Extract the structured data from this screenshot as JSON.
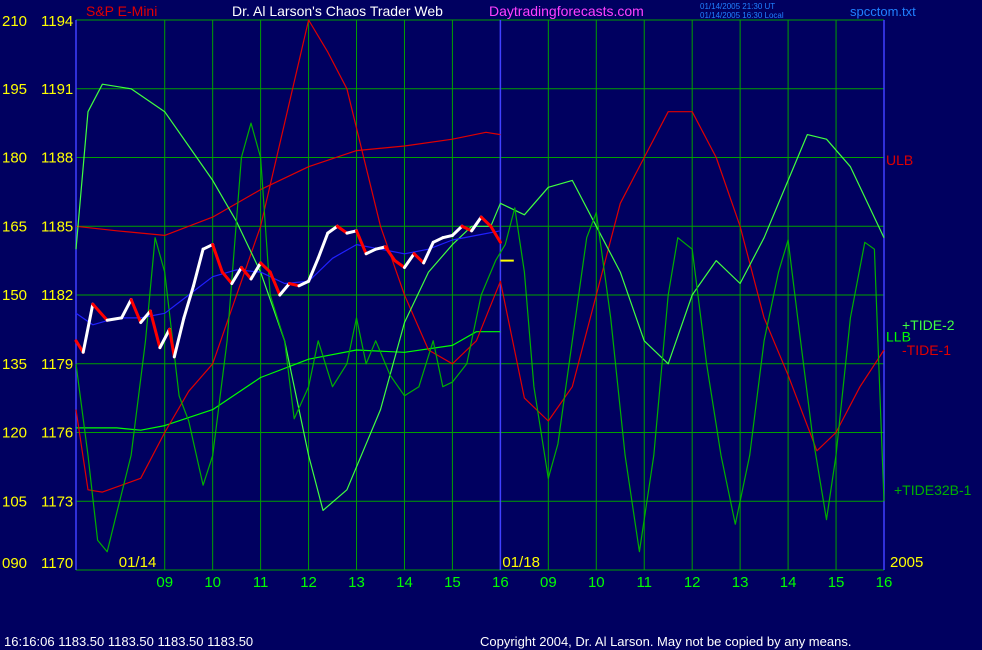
{
  "header": {
    "instrument": "S&P E-Mini",
    "title": "Dr. Al Larson's Chaos Trader Web",
    "site": "Daytradingforecasts.com",
    "stamp_ut": "01/14/2005 21:30 UT",
    "stamp_local": "01/14/2005 16:30 Local",
    "file": "spcctom.txt"
  },
  "footer": {
    "quote": "16:16:06  1183.50 1183.50 1183.50 1183.50",
    "copyright": "Copyright 2004, Dr. Al Larson. May not be copied by any means."
  },
  "colors": {
    "background": "#000060",
    "grid": "#00a000",
    "divider": "#4040ff",
    "left_axis": "#ffff00",
    "hour_labels": "#00ff00",
    "ulb": "#e00000",
    "llb": "#00ff00",
    "tide1": "#e00000",
    "tide2": "#40ff40",
    "tide32": "#00b000",
    "price_up": "#ffffff",
    "price_down": "#ff0000",
    "moving_avg": "#2020ff",
    "last_tick": "#ffff00"
  },
  "chart_data": {
    "type": "line",
    "left_axis": {
      "pairs": [
        {
          "osc": "210",
          "price": "1194"
        },
        {
          "osc": "195",
          "price": "1191"
        },
        {
          "osc": "180",
          "price": "1188"
        },
        {
          "osc": "165",
          "price": "1185"
        },
        {
          "osc": "150",
          "price": "1182"
        },
        {
          "osc": "135",
          "price": "1179"
        },
        {
          "osc": "120",
          "price": "1176"
        },
        {
          "osc": "105",
          "price": "1173"
        },
        {
          "osc": "090",
          "price": "1170"
        }
      ],
      "price_range": [
        1170,
        1194
      ],
      "osc_range": [
        90,
        210
      ]
    },
    "x_axis": {
      "range": [
        0,
        16
      ],
      "hour_ticks": [
        {
          "x": 1,
          "label": "09"
        },
        {
          "x": 2,
          "label": "10"
        },
        {
          "x": 3,
          "label": "11"
        },
        {
          "x": 4,
          "label": "12"
        },
        {
          "x": 5,
          "label": "13"
        },
        {
          "x": 6,
          "label": "14"
        },
        {
          "x": 7,
          "label": "15"
        },
        {
          "x": 8,
          "label": "16"
        },
        {
          "x": 9,
          "label": "09"
        },
        {
          "x": 10,
          "label": "10"
        },
        {
          "x": 11,
          "label": "11"
        },
        {
          "x": 12,
          "label": "12"
        },
        {
          "x": 13,
          "label": "13"
        },
        {
          "x": 14,
          "label": "14"
        },
        {
          "x": 15,
          "label": "15"
        },
        {
          "x": 16,
          "label": "16"
        }
      ],
      "date_labels": [
        {
          "x": 0,
          "label": "01/14"
        },
        {
          "x": 8,
          "label": "01/18"
        },
        {
          "x": 16,
          "label": "2005"
        }
      ],
      "day_divider_x": 8
    },
    "grid": true,
    "series_labels": [
      {
        "key": "ulb",
        "text": "ULB",
        "x": 16,
        "price": 1187.9
      },
      {
        "key": "tide2",
        "text": "+TIDE-2",
        "x": 16,
        "price": 1180.7
      },
      {
        "key": "llb",
        "text": "LLB",
        "x": 16,
        "price": 1180.2
      },
      {
        "key": "tide1",
        "text": "-TIDE-1",
        "x": 16,
        "price": 1179.6
      },
      {
        "key": "tide32",
        "text": "+TIDE32B-1",
        "x": 16,
        "price": 1173.5
      }
    ],
    "series": [
      {
        "key": "ulb",
        "points": [
          [
            -0.85,
            1185
          ],
          [
            0,
            1184.8
          ],
          [
            1,
            1184.6
          ],
          [
            2,
            1185.4
          ],
          [
            3,
            1186.6
          ],
          [
            4,
            1187.6
          ],
          [
            5,
            1188.3
          ],
          [
            6,
            1188.5
          ],
          [
            7,
            1188.8
          ],
          [
            7.7,
            1189.1
          ],
          [
            8,
            1189
          ]
        ]
      },
      {
        "key": "llb",
        "points": [
          [
            -0.85,
            1176.2
          ],
          [
            0,
            1176.2
          ],
          [
            0.5,
            1176.1
          ],
          [
            1,
            1176.3
          ],
          [
            2,
            1177
          ],
          [
            3,
            1178.4
          ],
          [
            4,
            1179.2
          ],
          [
            5,
            1179.6
          ],
          [
            6,
            1179.5
          ],
          [
            7,
            1179.8
          ],
          [
            7.5,
            1180.4
          ],
          [
            8,
            1180.4
          ]
        ]
      },
      {
        "key": "tide1",
        "points": [
          [
            -0.85,
            1177
          ],
          [
            -0.6,
            1173.5
          ],
          [
            -0.3,
            1173.4
          ],
          [
            0.5,
            1174
          ],
          [
            1,
            1176
          ],
          [
            1.5,
            1177.8
          ],
          [
            2,
            1179
          ],
          [
            2.5,
            1182
          ],
          [
            3,
            1185
          ],
          [
            3.5,
            1189.5
          ],
          [
            4,
            1194
          ],
          [
            4.4,
            1192.6
          ],
          [
            4.8,
            1191
          ],
          [
            5.5,
            1185
          ],
          [
            6,
            1182
          ],
          [
            6.5,
            1179.6
          ],
          [
            7,
            1179
          ],
          [
            7.5,
            1180
          ],
          [
            8,
            1182.6
          ],
          [
            8.5,
            1177.5
          ],
          [
            9,
            1176.5
          ],
          [
            9.5,
            1178
          ],
          [
            10,
            1182
          ],
          [
            10.5,
            1186
          ],
          [
            11,
            1188
          ],
          [
            11.5,
            1190
          ],
          [
            12,
            1190
          ],
          [
            12.5,
            1188
          ],
          [
            13,
            1185
          ],
          [
            13.5,
            1181
          ],
          [
            14,
            1178.5
          ],
          [
            14.6,
            1175.2
          ],
          [
            15,
            1176
          ],
          [
            15.5,
            1178
          ],
          [
            16,
            1179.6
          ]
        ]
      },
      {
        "key": "tide2",
        "points": [
          [
            -0.85,
            1184
          ],
          [
            -0.6,
            1190
          ],
          [
            -0.3,
            1191.2
          ],
          [
            0.3,
            1191
          ],
          [
            1,
            1190
          ],
          [
            1.5,
            1188.5
          ],
          [
            2,
            1187
          ],
          [
            2.5,
            1185.2
          ],
          [
            3,
            1183
          ],
          [
            3.5,
            1180
          ],
          [
            4,
            1175
          ],
          [
            4.3,
            1172.6
          ],
          [
            4.8,
            1173.5
          ],
          [
            5.5,
            1177
          ],
          [
            6,
            1180.8
          ],
          [
            6.5,
            1183
          ],
          [
            7,
            1184.2
          ],
          [
            7.4,
            1185
          ],
          [
            7.8,
            1185
          ],
          [
            8,
            1186
          ],
          [
            8.5,
            1185.5
          ],
          [
            9,
            1186.7
          ],
          [
            9.5,
            1187
          ],
          [
            10,
            1185
          ],
          [
            10.5,
            1183
          ],
          [
            11,
            1180
          ],
          [
            11.5,
            1179
          ],
          [
            12,
            1182
          ],
          [
            12.5,
            1183.5
          ],
          [
            13,
            1182.5
          ],
          [
            13.5,
            1184.5
          ],
          [
            14,
            1187
          ],
          [
            14.4,
            1189
          ],
          [
            14.8,
            1188.8
          ],
          [
            15.3,
            1187.6
          ],
          [
            16,
            1184.5
          ]
        ]
      },
      {
        "key": "tide32",
        "points": [
          [
            -0.85,
            1179
          ],
          [
            -0.6,
            1175
          ],
          [
            -0.4,
            1171.3
          ],
          [
            -0.2,
            1170.8
          ],
          [
            0,
            1172.5
          ],
          [
            0.3,
            1175
          ],
          [
            0.6,
            1180
          ],
          [
            0.8,
            1184.5
          ],
          [
            1,
            1183
          ],
          [
            1.3,
            1177.6
          ],
          [
            1.5,
            1176.5
          ],
          [
            1.8,
            1173.7
          ],
          [
            2,
            1175
          ],
          [
            2.3,
            1180
          ],
          [
            2.6,
            1188
          ],
          [
            2.8,
            1189.5
          ],
          [
            3,
            1188
          ],
          [
            3.2,
            1182
          ],
          [
            3.5,
            1180
          ],
          [
            3.7,
            1176.6
          ],
          [
            4,
            1178
          ],
          [
            4.2,
            1180
          ],
          [
            4.5,
            1178
          ],
          [
            4.8,
            1179
          ],
          [
            5,
            1181
          ],
          [
            5.2,
            1179
          ],
          [
            5.4,
            1180
          ],
          [
            5.7,
            1178.5
          ],
          [
            6,
            1177.6
          ],
          [
            6.3,
            1178
          ],
          [
            6.6,
            1180
          ],
          [
            6.8,
            1178
          ],
          [
            7,
            1178.2
          ],
          [
            7.3,
            1179
          ],
          [
            7.6,
            1182
          ],
          [
            7.9,
            1183.5
          ],
          [
            8.1,
            1184.2
          ],
          [
            8.3,
            1185.8
          ],
          [
            8.5,
            1183
          ],
          [
            8.7,
            1178
          ],
          [
            9,
            1174
          ],
          [
            9.2,
            1175.5
          ],
          [
            9.5,
            1180
          ],
          [
            9.8,
            1184.5
          ],
          [
            10,
            1185.6
          ],
          [
            10.3,
            1181
          ],
          [
            10.6,
            1175
          ],
          [
            10.9,
            1170.8
          ],
          [
            11.2,
            1175
          ],
          [
            11.5,
            1182
          ],
          [
            11.7,
            1184.5
          ],
          [
            12,
            1184
          ],
          [
            12.3,
            1179
          ],
          [
            12.6,
            1175
          ],
          [
            12.9,
            1172
          ],
          [
            13.2,
            1175
          ],
          [
            13.5,
            1180
          ],
          [
            13.8,
            1183
          ],
          [
            14,
            1184.4
          ],
          [
            14.2,
            1181
          ],
          [
            14.5,
            1176
          ],
          [
            14.8,
            1172.2
          ],
          [
            15,
            1175
          ],
          [
            15.3,
            1181
          ],
          [
            15.6,
            1184.3
          ],
          [
            15.8,
            1184
          ],
          [
            16,
            1173
          ]
        ]
      },
      {
        "key": "moving_avg",
        "points": [
          [
            -0.85,
            1181.2
          ],
          [
            -0.5,
            1180.7
          ],
          [
            0,
            1181
          ],
          [
            0.5,
            1181
          ],
          [
            1,
            1181.2
          ],
          [
            1.5,
            1182
          ],
          [
            2,
            1182.8
          ],
          [
            2.5,
            1183.1
          ],
          [
            3,
            1183
          ],
          [
            3.5,
            1182.5
          ],
          [
            4,
            1182.6
          ],
          [
            4.5,
            1183.6
          ],
          [
            5,
            1184.2
          ],
          [
            5.5,
            1184
          ],
          [
            6,
            1183.8
          ],
          [
            6.5,
            1184
          ],
          [
            7,
            1184.4
          ],
          [
            7.5,
            1184.6
          ],
          [
            8,
            1184.8
          ]
        ]
      },
      {
        "key": "price",
        "points": [
          [
            -0.85,
            1180
          ],
          [
            -0.7,
            1179.5
          ],
          [
            -0.5,
            1181.6
          ],
          [
            -0.2,
            1180.9
          ],
          [
            0.1,
            1181
          ],
          [
            0.3,
            1181.8
          ],
          [
            0.5,
            1180.8
          ],
          [
            0.7,
            1181.3
          ],
          [
            0.9,
            1179.7
          ],
          [
            1.1,
            1180.5
          ],
          [
            1.2,
            1179.3
          ],
          [
            1.4,
            1181
          ],
          [
            1.6,
            1182.4
          ],
          [
            1.8,
            1184
          ],
          [
            2,
            1184.2
          ],
          [
            2.2,
            1183
          ],
          [
            2.4,
            1182.5
          ],
          [
            2.6,
            1183.2
          ],
          [
            2.8,
            1182.7
          ],
          [
            3,
            1183.4
          ],
          [
            3.2,
            1183
          ],
          [
            3.4,
            1182
          ],
          [
            3.6,
            1182.5
          ],
          [
            3.8,
            1182.4
          ],
          [
            4,
            1182.6
          ],
          [
            4.2,
            1183.6
          ],
          [
            4.4,
            1184.7
          ],
          [
            4.6,
            1185
          ],
          [
            4.8,
            1184.7
          ],
          [
            5,
            1184.8
          ],
          [
            5.2,
            1183.8
          ],
          [
            5.4,
            1184
          ],
          [
            5.6,
            1184.1
          ],
          [
            5.8,
            1183.5
          ],
          [
            6,
            1183.2
          ],
          [
            6.2,
            1183.8
          ],
          [
            6.4,
            1183.4
          ],
          [
            6.6,
            1184.3
          ],
          [
            6.8,
            1184.5
          ],
          [
            7,
            1184.6
          ],
          [
            7.2,
            1185
          ],
          [
            7.4,
            1184.8
          ],
          [
            7.6,
            1185.4
          ],
          [
            7.8,
            1185
          ],
          [
            8,
            1184.3
          ]
        ]
      },
      {
        "key": "last_tick",
        "points": [
          [
            8,
            1183.5
          ],
          [
            8.28,
            1183.5
          ]
        ]
      }
    ]
  }
}
